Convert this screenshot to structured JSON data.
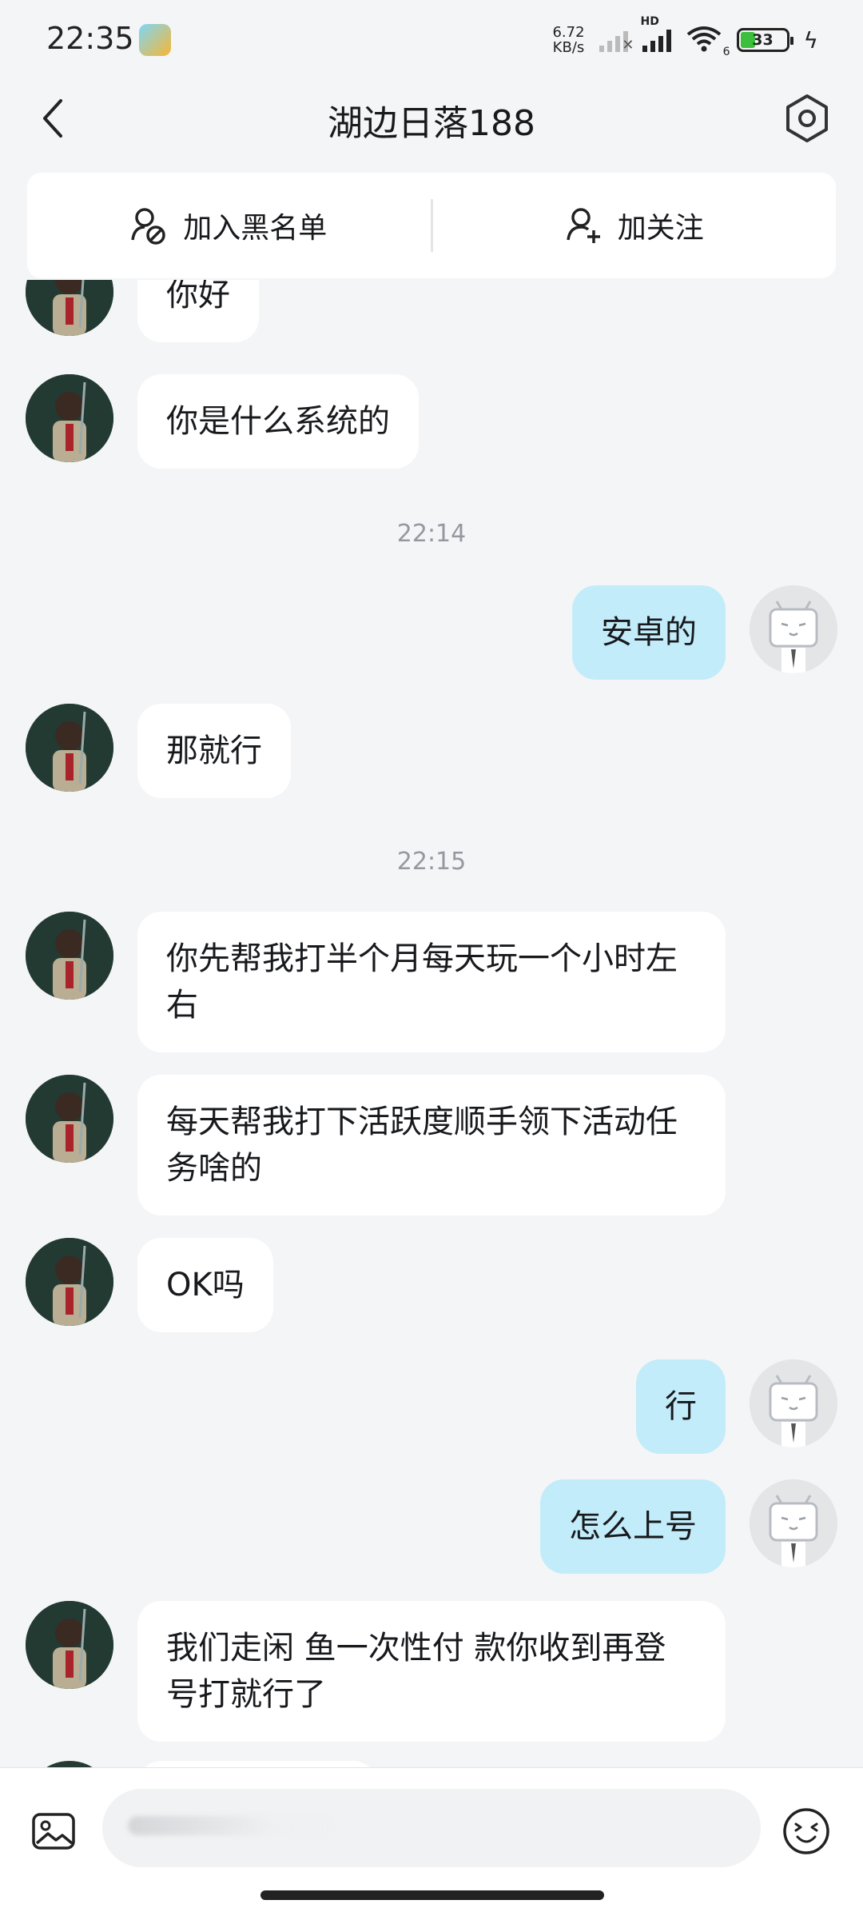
{
  "status_bar": {
    "time": "22:35",
    "net_speed_value": "6.72",
    "net_speed_unit": "KB/s",
    "hd_label": "HD",
    "wifi_label": "6",
    "battery": "33"
  },
  "nav": {
    "title": "湖边日落188"
  },
  "actions": {
    "blacklist_label": "加入黑名单",
    "follow_label": "加关注"
  },
  "messages": [
    {
      "sender": "other",
      "text": "你好"
    },
    {
      "sender": "other",
      "text": "你是什么系统的"
    },
    {
      "type": "time",
      "text": "22:14"
    },
    {
      "sender": "me",
      "text": "安卓的"
    },
    {
      "sender": "other",
      "text": "那就行"
    },
    {
      "type": "time",
      "text": "22:15"
    },
    {
      "sender": "other",
      "text": "你先帮我打半个月每天玩一个小时左右"
    },
    {
      "sender": "other",
      "text": "每天帮我打下活跃度顺手领下活动任务啥的"
    },
    {
      "sender": "other",
      "text": "OK吗"
    },
    {
      "sender": "me",
      "text": "行"
    },
    {
      "sender": "me",
      "text": "怎么上号"
    },
    {
      "sender": "other",
      "text": "我们走闲 鱼一次性付 款你收到再登号打就行了"
    }
  ],
  "input": {
    "placeholder": ""
  },
  "colors": {
    "background": "#f4f5f7",
    "my_bubble": "#c2ecf9",
    "other_bubble": "#ffffff",
    "timestamp": "#9499a0"
  }
}
